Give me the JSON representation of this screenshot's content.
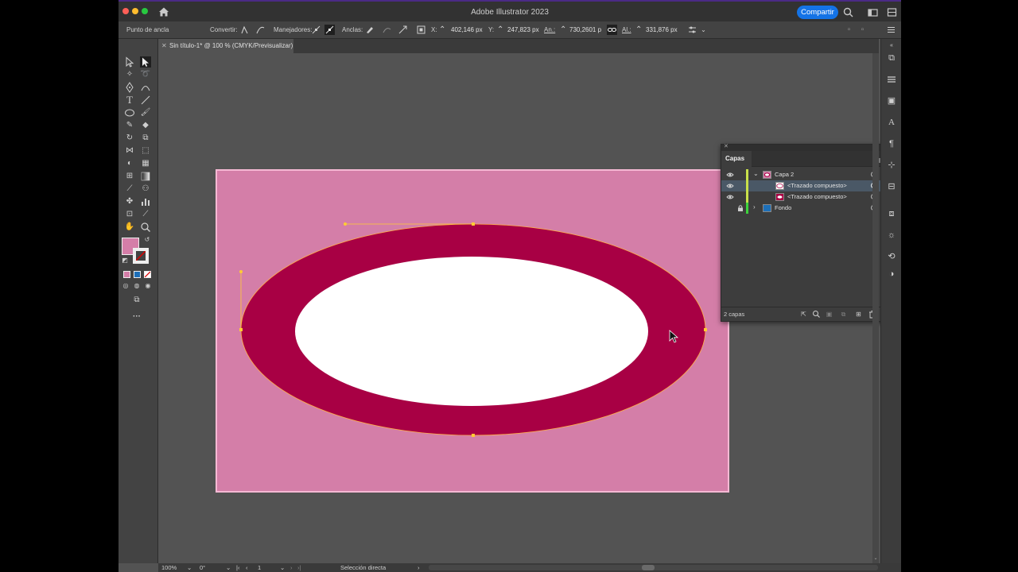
{
  "app_title": "Adobe Illustrator 2023",
  "share_label": "Compartir",
  "control_bar": {
    "selection_type": "Punto de ancla",
    "convert_label": "Convertir:",
    "handles_label": "Manejadores:",
    "anchors_label": "Anclas:",
    "x_label": "X:",
    "x_value": "402,146 px",
    "y_label": "Y:",
    "y_value": "247,823 px",
    "width_label": "An.:",
    "width_value": "730,2601 p",
    "height_label": "Al.:",
    "height_value": "331,876 px"
  },
  "document_tab": "Sin título-1* @ 100 % (CMYK/Previsualizar)",
  "layers_panel": {
    "title": "Capas",
    "rows": [
      {
        "name": "Capa 2",
        "color": "#c8e04a"
      },
      {
        "name": "<Trazado compuesto>",
        "color": "#c8e04a"
      },
      {
        "name": "<Trazado compuesto>",
        "color": "#c8e04a"
      },
      {
        "name": "Fondo",
        "color": "#3cd43c"
      }
    ],
    "footer_count": "2 capas"
  },
  "status_bar": {
    "zoom": "100%",
    "rotation": "0°",
    "artboard_number": "1",
    "tool_name": "Selección directa"
  },
  "colors": {
    "artboard": "#d47ea8",
    "ring": "#a80044",
    "hole": "#ffffff",
    "fill_swatch": "#d47ea8",
    "accent": "#1473e6"
  }
}
